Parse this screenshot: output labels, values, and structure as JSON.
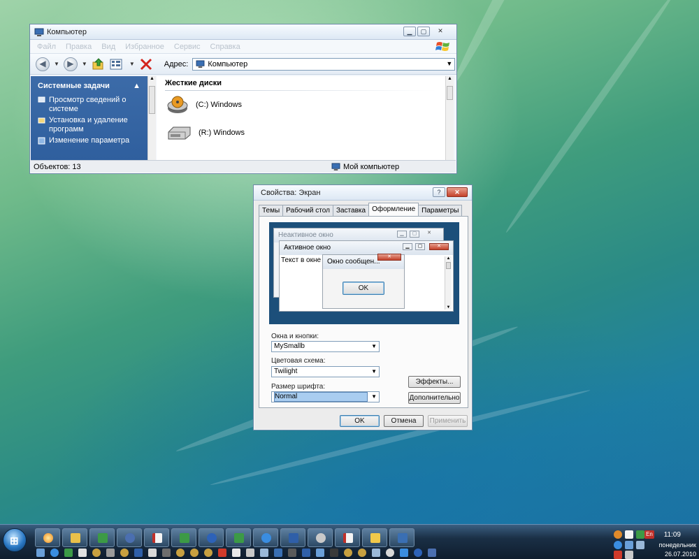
{
  "explorer": {
    "title": "Компьютер",
    "menu": [
      "Файл",
      "Правка",
      "Вид",
      "Избранное",
      "Сервис",
      "Справка"
    ],
    "address_label": "Адрес:",
    "address_value": "Компьютер",
    "tasks_header": "Системные задачи",
    "tasks": [
      "Просмотр сведений о системе",
      "Установка и удаление программ",
      "Изменение параметра"
    ],
    "group_header": "Жесткие диски",
    "drives": [
      "(C:) Windows",
      "(R:) Windows"
    ],
    "status_count": "Объектов: 13",
    "status_location": "Мой компьютер"
  },
  "dialog": {
    "title": "Свойства: Экран",
    "tabs": [
      "Темы",
      "Рабочий стол",
      "Заставка",
      "Оформление",
      "Параметры"
    ],
    "active_tab": "Оформление",
    "preview": {
      "inactive_title": "Неактивное окно",
      "active_title": "Активное окно",
      "window_text": "Текст в окне",
      "message_title": "Окно сообщен...",
      "message_ok": "OK"
    },
    "windows_buttons_label": "Окна и кнопки:",
    "windows_buttons_value": "MySmallb",
    "color_scheme_label": "Цветовая схема:",
    "color_scheme_value": "Twilight",
    "font_size_label": "Размер шрифта:",
    "font_size_value": "Normal",
    "effects_button": "Эффекты...",
    "advanced_button": "Дополнительно",
    "ok_button": "OK",
    "cancel_button": "Отмена",
    "apply_button": "Применить"
  },
  "taskbar": {
    "clock_time": "11:09",
    "clock_day": "понедельник",
    "clock_date": "26.07.2010",
    "lang": "En"
  }
}
